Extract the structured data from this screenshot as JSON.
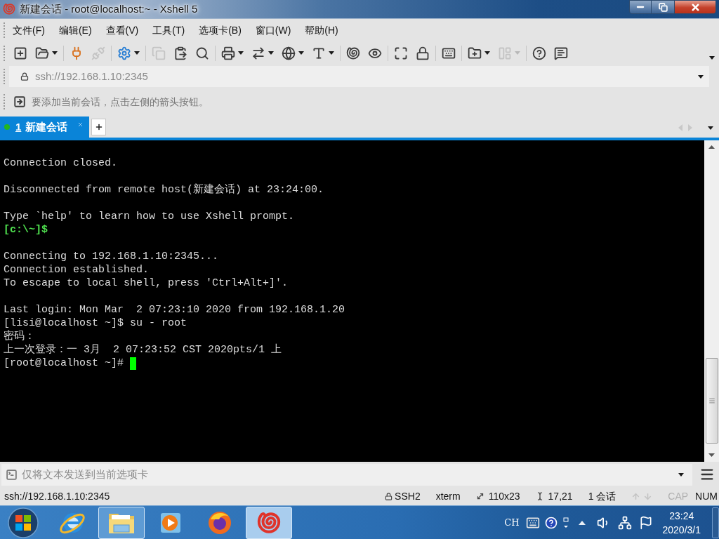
{
  "window": {
    "title": "新建会话 - root@localhost:~ - Xshell 5"
  },
  "menu": [
    "文件(F)",
    "编辑(E)",
    "查看(V)",
    "工具(T)",
    "选项卡(B)",
    "窗口(W)",
    "帮助(H)"
  ],
  "toolbar": {
    "groups": [
      [
        {
          "kind": "new_session",
          "disabled": false,
          "dropdown": false
        },
        {
          "kind": "open",
          "disabled": false,
          "dropdown": true
        }
      ],
      [
        {
          "kind": "connect",
          "disabled": false,
          "dropdown": false
        },
        {
          "kind": "disconnect",
          "disabled": true,
          "dropdown": false
        }
      ],
      [
        {
          "kind": "properties",
          "disabled": false,
          "dropdown": true
        }
      ],
      [
        {
          "kind": "copy",
          "disabled": true,
          "dropdown": false
        },
        {
          "kind": "paste",
          "disabled": false,
          "dropdown": false
        },
        {
          "kind": "find",
          "disabled": false,
          "dropdown": false
        }
      ],
      [
        {
          "kind": "print",
          "disabled": false,
          "dropdown": true
        },
        {
          "kind": "transfer",
          "disabled": false,
          "dropdown": true
        },
        {
          "kind": "web",
          "disabled": false,
          "dropdown": true
        },
        {
          "kind": "font",
          "disabled": false,
          "dropdown": true
        }
      ],
      [
        {
          "kind": "file_transfer",
          "disabled": false,
          "dropdown": false
        },
        {
          "kind": "x_window",
          "disabled": false,
          "dropdown": false
        }
      ],
      [
        {
          "kind": "fullscreen",
          "disabled": false,
          "dropdown": false
        },
        {
          "kind": "lock",
          "disabled": false,
          "dropdown": false
        }
      ],
      [
        {
          "kind": "keyboard",
          "disabled": false,
          "dropdown": false
        }
      ],
      [
        {
          "kind": "new_group",
          "disabled": false,
          "dropdown": true
        },
        {
          "kind": "layout",
          "disabled": true,
          "dropdown": true
        }
      ],
      [
        {
          "kind": "help",
          "disabled": false,
          "dropdown": false
        },
        {
          "kind": "chat",
          "disabled": false,
          "dropdown": false
        }
      ]
    ]
  },
  "address_bar": {
    "value": "ssh://192.168.1.10:2345"
  },
  "hint_bar": {
    "text": "要添加当前会话，点击左侧的箭头按钮。"
  },
  "tabs": [
    {
      "number": "1",
      "label": "新建会话",
      "selected": true,
      "connected": true
    }
  ],
  "tab_nav": {
    "back_disabled": true,
    "forward_disabled": true
  },
  "terminal": {
    "blocks": [
      [
        {
          "kind": "output",
          "text": "Connection closed.",
          "cursor": false
        }
      ],
      [
        {
          "kind": "output",
          "text": "Disconnected from remote host(新建会话) at 23:24:00.",
          "cursor": false
        }
      ],
      [
        {
          "kind": "output",
          "text": "Type `help' to learn how to use Xshell prompt.",
          "cursor": false
        },
        {
          "kind": "local_prompt",
          "text": "[c:\\~]$",
          "cursor": false
        }
      ],
      [
        {
          "kind": "output",
          "text": "Connecting to 192.168.1.10:2345...",
          "cursor": false
        },
        {
          "kind": "output",
          "text": "Connection established.",
          "cursor": false
        },
        {
          "kind": "output",
          "text": "To escape to local shell, press 'Ctrl+Alt+]'.",
          "cursor": false
        }
      ],
      [
        {
          "kind": "output",
          "text": "Last login: Mon Mar  2 07:23:10 2020 from 192.168.1.20",
          "cursor": false
        },
        {
          "kind": "output",
          "text": "[lisi@localhost ~]$ su - root",
          "cursor": false
        },
        {
          "kind": "output",
          "text": "密码：",
          "cursor": false
        },
        {
          "kind": "output",
          "text": "上一次登录：一 3月  2 07:23:52 CST 2020pts/1 上",
          "cursor": false
        },
        {
          "kind": "output",
          "text": "[root@localhost ~]#",
          "cursor": true
        }
      ]
    ]
  },
  "compose_bar": {
    "placeholder": "仅将文本发送到当前选项卡"
  },
  "status_bar": {
    "address": "ssh://192.168.1.10:2345",
    "items": [
      {
        "kind": "protocol",
        "text": "SSH2"
      },
      {
        "kind": "plain",
        "text": "xterm"
      },
      {
        "kind": "size",
        "text": "110x23"
      },
      {
        "kind": "position",
        "text": "17,21"
      },
      {
        "kind": "plain",
        "text": "1 会话"
      }
    ],
    "arrows_disabled": true,
    "keys": [
      {
        "label": "CAP",
        "on": false
      },
      {
        "label": "NUM",
        "on": true
      }
    ]
  },
  "taskbar": {
    "apps": [
      {
        "kind": "browser",
        "open": false,
        "active": false
      },
      {
        "kind": "folder",
        "open": true,
        "active": false
      },
      {
        "kind": "player",
        "open": false,
        "active": false
      },
      {
        "kind": "fox_browser",
        "open": false,
        "active": false
      },
      {
        "kind": "shell",
        "open": true,
        "active": true
      }
    ]
  },
  "tray": {
    "language": "CH",
    "time": "23:24",
    "date": "2020/3/1"
  }
}
